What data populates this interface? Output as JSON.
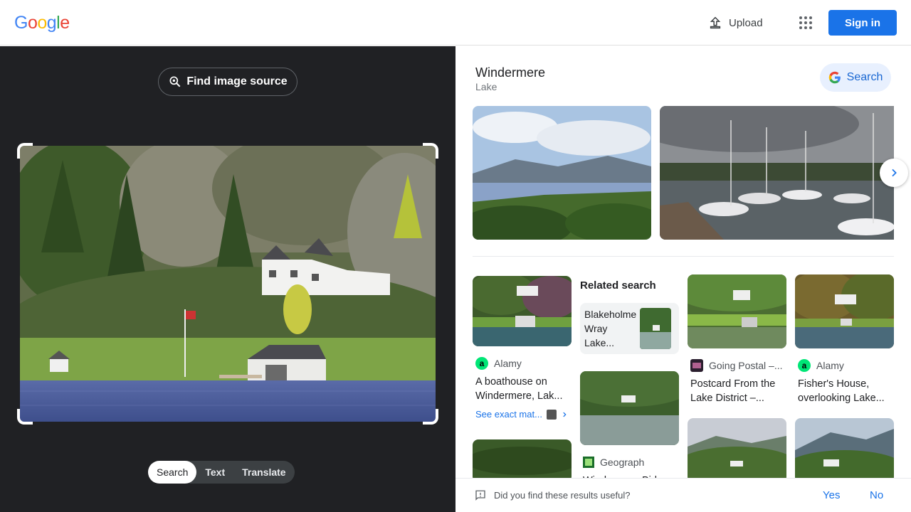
{
  "header": {
    "logo": [
      "G",
      "o",
      "o",
      "g",
      "l",
      "e"
    ],
    "logo_colors": [
      "#4285F4",
      "#EA4335",
      "#FBBC05",
      "#4285F4",
      "#34A853",
      "#EA4335"
    ],
    "upload_label": "Upload",
    "signin_label": "Sign in"
  },
  "left": {
    "find_source_label": "Find image source",
    "tabs": [
      "Search",
      "Text",
      "Translate"
    ],
    "active_tab": "Search"
  },
  "kg": {
    "title": "Windermere",
    "subtitle": "Lake",
    "search_label": "Search"
  },
  "results": {
    "cards": [
      {
        "source": "Alamy",
        "title_line1": "A boathouse on",
        "title_line2": "Windermere, Lak...",
        "see_exact": "See exact mat..."
      },
      {
        "source": "Geograph",
        "title_line1": "Windermere Birk..."
      },
      {
        "source": "Going Postal –...",
        "title_line1": "Postcard From the",
        "title_line2": "Lake District –..."
      },
      {
        "source": "Alamy",
        "title_line1": "Fisher's House,",
        "title_line2": "overlooking Lake..."
      }
    ],
    "related_title": "Related search",
    "related_text": "Blakeholme Wray Lake..."
  },
  "feedback": {
    "question": "Did you find these results useful?",
    "yes": "Yes",
    "no": "No"
  },
  "colors": {
    "accent": "#1a73e8",
    "dark_bg": "#202124"
  }
}
